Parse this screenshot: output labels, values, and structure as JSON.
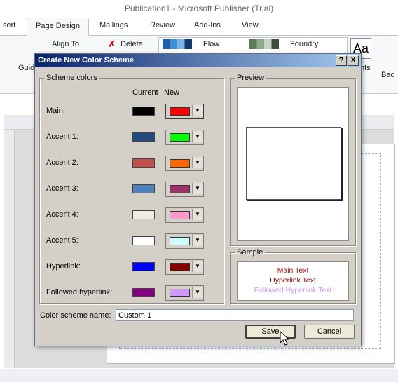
{
  "app": {
    "title": "Publication1 - Microsoft Publisher (Trial)"
  },
  "ribbon": {
    "tabs": [
      "sert",
      "Page Design",
      "Mailings",
      "Review",
      "Add-Ins",
      "View"
    ],
    "align_to": "Align To",
    "delete": "Delete",
    "guides_partial": "Guid",
    "scheme_flow": "Flow",
    "scheme_foundry": "Foundry",
    "fonts_icon": "Aa",
    "nts_partial": "nts",
    "bac_partial": "Bac"
  },
  "dialog": {
    "title": "Create New Color Scheme",
    "help_button": "?",
    "close_button": "X",
    "scheme_colors_label": "Scheme colors",
    "current_header": "Current",
    "new_header": "New",
    "rows": [
      {
        "label": "Main:",
        "current": "#000000",
        "new": "#ff0000"
      },
      {
        "label": "Accent 1:",
        "current": "#1f497d",
        "new": "#00ff00"
      },
      {
        "label": "Accent 2:",
        "current": "#c0504d",
        "new": "#ff6600"
      },
      {
        "label": "Accent 3:",
        "current": "#4f81bd",
        "new": "#993366"
      },
      {
        "label": "Accent 4:",
        "current": "#eeece1",
        "new": "#ff99cc"
      },
      {
        "label": "Accent 5:",
        "current": "#ffffff",
        "new": "#ccffff"
      },
      {
        "label": "Hyperlink:",
        "current": "#0000ff",
        "new": "#800000"
      },
      {
        "label": "Followed hyperlink:",
        "current": "#800080",
        "new": "#cc99ff"
      }
    ],
    "preview_label": "Preview",
    "sample_label": "Sample",
    "sample": {
      "main_text": "Main Text",
      "hyperlink_text": "Hyperlink Text",
      "followed_text": "Followed Hyperlink Text"
    },
    "name_label": "Color scheme name:",
    "name_value": "Custom 1",
    "save_button": "Save",
    "cancel_button": "Cancel"
  }
}
